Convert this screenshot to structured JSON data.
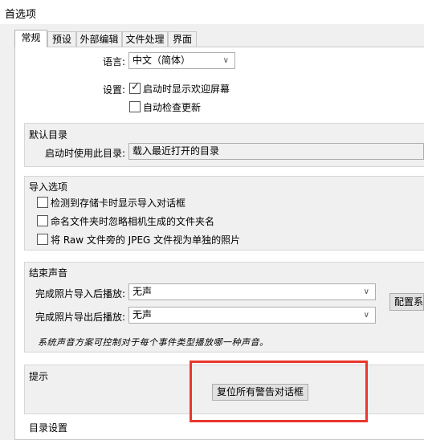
{
  "window": {
    "title": "首选项"
  },
  "tabs": [
    {
      "label": "常规",
      "active": true
    },
    {
      "label": "预设",
      "active": false
    },
    {
      "label": "外部编辑",
      "active": false
    },
    {
      "label": "文件处理",
      "active": false
    },
    {
      "label": "界面",
      "active": false
    }
  ],
  "general": {
    "language_label": "语言:",
    "language_value": "中文（简体）",
    "settings_label": "设置:",
    "show_splash": {
      "label": "启动时显示欢迎屏幕",
      "checked": true
    },
    "check_updates": {
      "label": "自动检查更新",
      "checked": false
    }
  },
  "default_catalog": {
    "title": "默认目录",
    "startup_label": "启动时使用此目录:",
    "startup_value": "载入最近打开的目录"
  },
  "import_options": {
    "title": "导入选项",
    "items": [
      {
        "label": "检测到存储卡时显示导入对话框",
        "checked": false
      },
      {
        "label": "命名文件夹时忽略相机生成的文件夹名",
        "checked": false
      },
      {
        "label": "将 Raw 文件旁的 JPEG 文件视为单独的照片",
        "checked": false
      }
    ]
  },
  "completion_sounds": {
    "title": "结束声音",
    "import_label": "完成照片导入后播放:",
    "import_value": "无声",
    "export_label": "完成照片导出后播放:",
    "export_value": "无声",
    "configure_button": "配置系",
    "note": "系统声音方案可控制对于每个事件类型播放哪一种声音。"
  },
  "prompts": {
    "title": "提示",
    "reset_button": "复位所有警告对话框"
  },
  "catalog_settings": {
    "title": "目录设置"
  }
}
